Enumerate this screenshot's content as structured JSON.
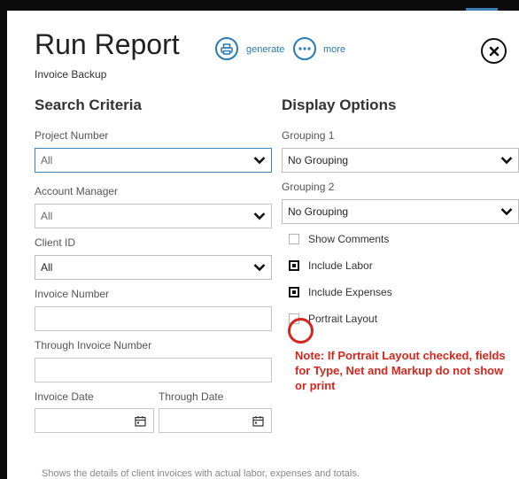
{
  "header": {
    "title": "Run Report",
    "subtitle": "Invoice Backup",
    "generate_label": "generate",
    "more_label": "more"
  },
  "search": {
    "heading": "Search Criteria",
    "project_number": {
      "label": "Project Number",
      "value": "All"
    },
    "account_manager": {
      "label": "Account Manager",
      "value": "All"
    },
    "client_id": {
      "label": "Client ID",
      "value": "All"
    },
    "invoice_number": {
      "label": "Invoice Number",
      "value": ""
    },
    "through_invoice_number": {
      "label": "Through Invoice Number",
      "value": ""
    },
    "invoice_date": {
      "label": "Invoice Date",
      "value": ""
    },
    "through_date": {
      "label": "Through Date",
      "value": ""
    }
  },
  "display": {
    "heading": "Display Options",
    "grouping1": {
      "label": "Grouping 1",
      "value": "No Grouping"
    },
    "grouping2": {
      "label": "Grouping 2",
      "value": "No Grouping"
    },
    "show_comments": {
      "label": "Show Comments",
      "checked": false
    },
    "include_labor": {
      "label": "Include Labor",
      "checked": true
    },
    "include_expenses": {
      "label": "Include Expenses",
      "checked": true
    },
    "portrait_layout": {
      "label": "Portrait Layout",
      "checked": false
    }
  },
  "annotation": {
    "note": "Note: If Portrait Layout checked, fields for Type, Net and Markup do not show or print"
  },
  "footer": {
    "description": "Shows the details of client invoices with actual labor, expenses and totals."
  },
  "colors": {
    "accent": "#2a7ab6",
    "annotation": "#d6261c"
  },
  "icons": {
    "generate": "print-icon",
    "more": "more-dots-icon",
    "close": "close-icon",
    "date": "calendar-icon"
  }
}
